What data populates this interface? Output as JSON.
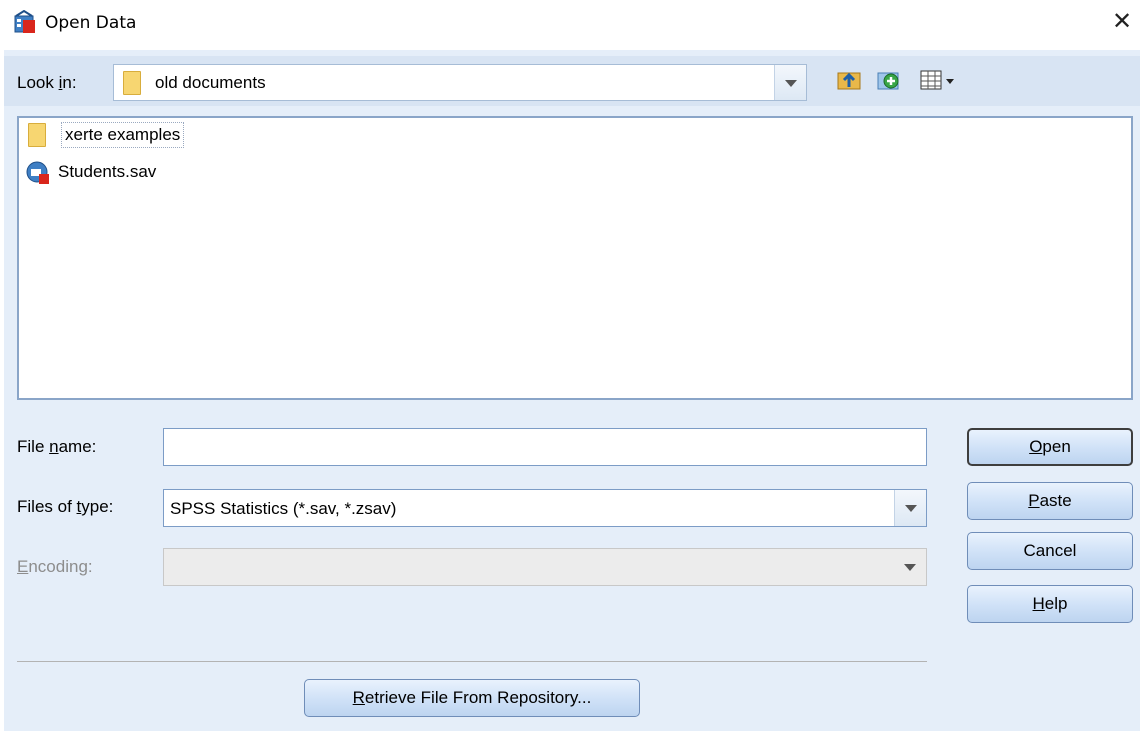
{
  "window": {
    "title": "Open Data",
    "close_glyph": "✕"
  },
  "lookin": {
    "label": "Look in:",
    "value": "old documents"
  },
  "toolbar": {
    "icons": [
      "up-folder-icon",
      "new-folder-icon",
      "view-menu-icon"
    ]
  },
  "files": [
    {
      "name": "xerte examples",
      "icon": "folder-icon",
      "selected": true
    },
    {
      "name": "Students.sav",
      "icon": "spss-data-file-icon",
      "selected": false
    }
  ],
  "form": {
    "filename_label": "File name:",
    "filename_value": "",
    "filetype_label": "Files of type:",
    "filetype_value": "SPSS Statistics (*.sav, *.zsav)",
    "encoding_label": "Encoding:",
    "encoding_value": ""
  },
  "buttons": {
    "open": "Open",
    "paste": "Paste",
    "cancel": "Cancel",
    "help": "Help",
    "retrieve": "Retrieve File From Repository..."
  },
  "colors": {
    "dialog_bg": "#e5eef9",
    "lookin_bg": "#d8e4f3",
    "button_border": "#6f8db8",
    "folder": "#f7d671"
  }
}
